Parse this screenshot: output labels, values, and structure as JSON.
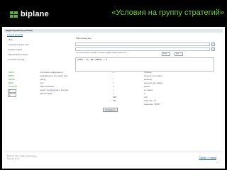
{
  "brand": {
    "logo_text": "biplane"
  },
  "slide": {
    "title": "«Условия на группу стратегий»"
  },
  "form": {
    "header": "Редактирование условия",
    "back_link": "Список условий",
    "rows": [
      {
        "label": "Имя",
        "value": "Убыточные дни"
      },
      {
        "label": "Автоматическое имя",
        "value": ""
      },
      {
        "label": "Комментарий",
        "value": ""
      },
      {
        "label": "Временной период",
        "value": "Этот период отбора стратегий на основании. Задайте период по умолчанию.",
        "period_from": "45 дн",
        "period_to": "0 дн"
      }
    ],
    "condition_label": "Условие отбора",
    "condition_text": "(CROI > 0) OR (DROI) < 0",
    "save_label": "Сохранить"
  },
  "legend": {
    "codes": [
      "CROI",
      "DROI",
      "CRCR",
      "DCR",
      "CCCP14",
      "N",
      "N"
    ],
    "descriptions": [
      "итоговый коэффициент",
      "коэффициент итоговый рост",
      "доход",
      "итог",
      "CPA снижение",
      "дней с предыдущего запуска",
      "дней продаж"
    ],
    "num_values": [
      "1",
      "1"
    ],
    "ops": [
      "+",
      "-",
      "*",
      "/",
      "=",
      "<",
      ">",
      "",
      "100",
      "VD"
    ],
    "op_desc": [
      "больше",
      "больше или равно",
      "меньше",
      "меньше или равно",
      "равно",
      "не равно",
      "и",
      "или",
      "значение 1Y",
      "значение \"1000\""
    ]
  },
  "footer": {
    "line1": "Biplane. Все права защищены.",
    "line2": "Версия 1.0.1",
    "link": "Связь с нами"
  },
  "colors": {
    "accent_green": "#6fcf3a",
    "link_blue": "#1b5ea8",
    "code_green": "#2a8a2a"
  }
}
